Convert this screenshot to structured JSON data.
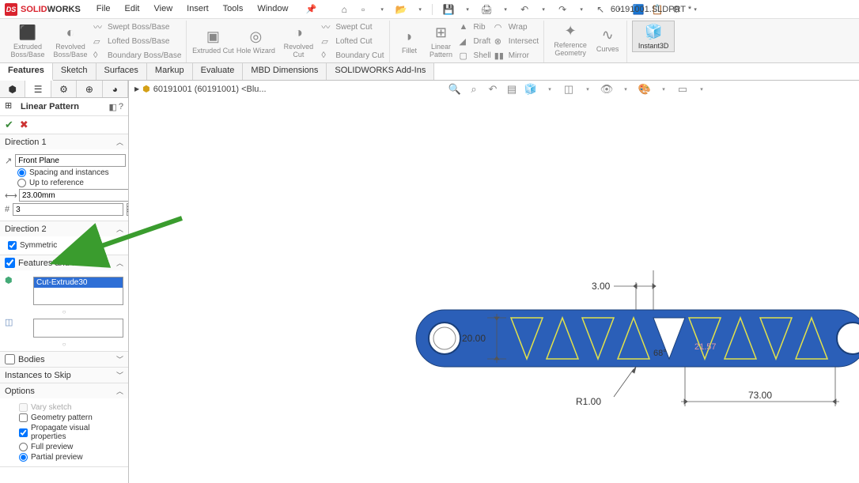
{
  "app": {
    "logo_prefix": "SOLID",
    "logo_suffix": "WORKS",
    "doc_title": "60191001.SLDPRT *"
  },
  "menu": {
    "items": [
      "File",
      "Edit",
      "View",
      "Insert",
      "Tools",
      "Window"
    ]
  },
  "ribbon": {
    "extruded_boss": "Extruded Boss/Base",
    "revolved_boss": "Revolved Boss/Base",
    "swept_boss": "Swept Boss/Base",
    "lofted_boss": "Lofted Boss/Base",
    "boundary_boss": "Boundary Boss/Base",
    "extruded_cut": "Extruded Cut",
    "hole_wizard": "Hole Wizard",
    "revolved_cut": "Revolved Cut",
    "swept_cut": "Swept Cut",
    "lofted_cut": "Lofted Cut",
    "boundary_cut": "Boundary Cut",
    "fillet": "Fillet",
    "linear_pattern": "Linear Pattern",
    "rib": "Rib",
    "draft": "Draft",
    "shell": "Shell",
    "wrap": "Wrap",
    "intersect": "Intersect",
    "mirror": "Mirror",
    "ref_geom": "Reference Geometry",
    "curves": "Curves",
    "instant3d": "Instant3D"
  },
  "tabs": {
    "items": [
      "Features",
      "Sketch",
      "Surfaces",
      "Markup",
      "Evaluate",
      "MBD Dimensions",
      "SOLIDWORKS Add-Ins"
    ],
    "active": 0
  },
  "tree_flyout": "60191001 (60191001) <Blu...",
  "pm": {
    "title": "Linear Pattern",
    "sections": {
      "direction1": {
        "label": "Direction 1",
        "ref_value": "Front Plane",
        "radio_spacing": "Spacing and instances",
        "radio_upto": "Up to reference",
        "spacing_value": "23.00mm",
        "instances_value": "3"
      },
      "direction2": {
        "label": "Direction 2",
        "symmetric": "Symmetric"
      },
      "features_faces": {
        "label": "Features and Faces",
        "selected_feature": "Cut-Extrude30"
      },
      "bodies": {
        "label": "Bodies"
      },
      "skip": {
        "label": "Instances to Skip"
      },
      "options": {
        "label": "Options",
        "vary_sketch": "Vary sketch",
        "geometry_pattern": "Geometry pattern",
        "propagate": "Propagate visual properties",
        "full_preview": "Full preview",
        "partial_preview": "Partial preview"
      }
    }
  },
  "dimensions": {
    "spacing_top": "3.00",
    "height": "20.00",
    "angle": "68°",
    "radius_label": "R1.00",
    "pitch": "73.00",
    "aux": "21.57"
  }
}
